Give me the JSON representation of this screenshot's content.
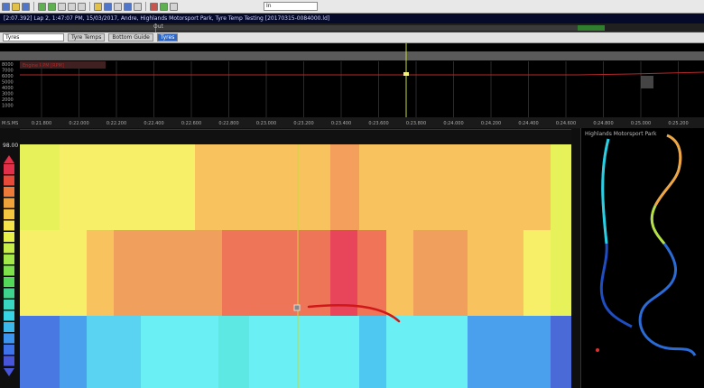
{
  "toolbar": {
    "buttons": [
      "new",
      "open",
      "save",
      "undo",
      "redo",
      "cursor",
      "zoom-in",
      "zoom-out",
      "settings",
      "help",
      "record",
      "play",
      "stop"
    ],
    "select_value": "In"
  },
  "title": "[2:07.392] Lap 2, 1:47:07 PM, 15/03/2017, Andre, Highlands Motorsport Park, Tyre Temp Testing [20170315-0084000.ld]",
  "lap_strip": {
    "label": "Out"
  },
  "workbook": {
    "selected": "Tyres",
    "tabs": [
      {
        "label": "Tyre Temps",
        "active": false
      },
      {
        "label": "Bottom Guide",
        "active": false
      },
      {
        "label": "Tyres",
        "active": true
      }
    ]
  },
  "time_plot": {
    "y_ticks": [
      "8000",
      "7000",
      "6000",
      "5000",
      "4000",
      "3000",
      "2000",
      "1000"
    ],
    "x_unit": "M:S.MS",
    "x_ticks": [
      "0:21.800",
      "0:22.000",
      "0:22.200",
      "0:22.400",
      "0:22.600",
      "0:22.800",
      "0:23.000",
      "0:23.200",
      "0:23.400",
      "0:23.600",
      "0:23.800",
      "0:24.000",
      "0:24.200",
      "0:24.400",
      "0:24.600",
      "0:24.800",
      "0:25.000",
      "0:25.200"
    ],
    "channel_label": "Engine RPM [RPM]"
  },
  "heatmap": {
    "scale_max": "98.00"
  },
  "map": {
    "title": "Highlands Motorsport Park"
  },
  "colors": {
    "toolbar_bg": "#e8e8e8",
    "title_bg": "#050a2a",
    "plot_bg": "#000000",
    "trace": "#b32828",
    "cursor": "#c7d93a"
  }
}
